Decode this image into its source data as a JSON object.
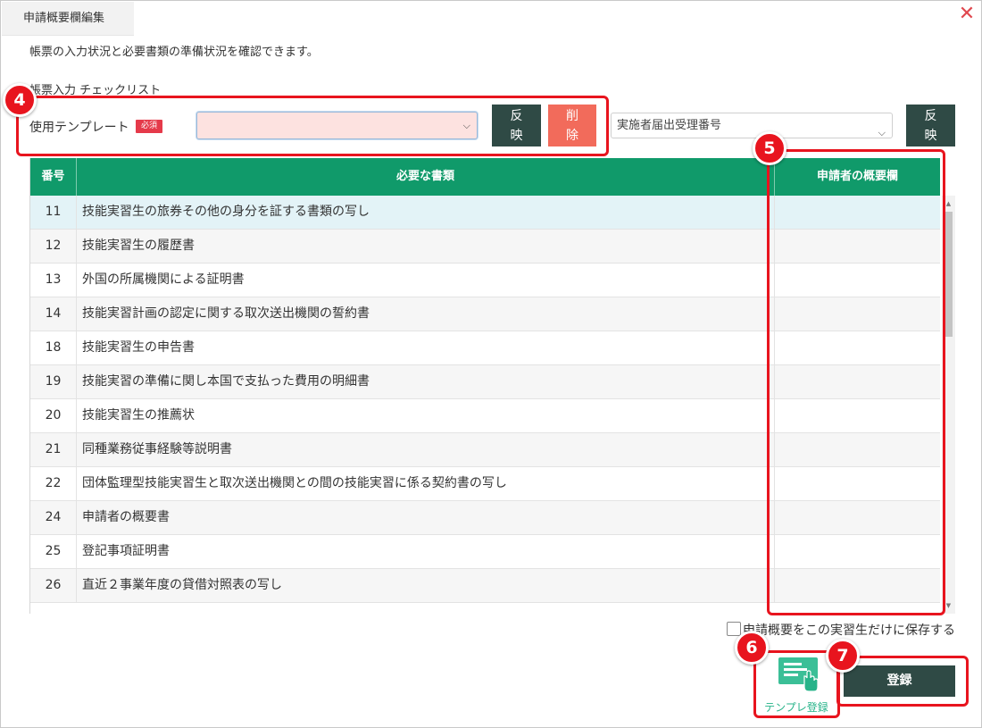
{
  "dialog": {
    "title": "申請概要欄編集",
    "close_glyph": "✕",
    "description": "帳票の入力状況と必要書類の準備状況を確認できます。",
    "section_label": "帳票入力 チェックリスト"
  },
  "template_row": {
    "label": "使用テンプレート",
    "required_badge": "必須",
    "select_value": "",
    "apply_button_line1": "反",
    "apply_button_line2": "映",
    "delete_button_line1": "削",
    "delete_button_line2": "除",
    "number_select_value": "実施者届出受理番号",
    "apply_button2_line1": "反",
    "apply_button2_line2": "映"
  },
  "table": {
    "headers": [
      "番号",
      "必要な書類",
      "申請者の概要欄"
    ],
    "rows": [
      {
        "no": "11",
        "doc": "技能実習生の旅券その他の身分を証する書類の写し",
        "summary": ""
      },
      {
        "no": "12",
        "doc": "技能実習生の履歴書",
        "summary": ""
      },
      {
        "no": "13",
        "doc": "外国の所属機関による証明書",
        "summary": ""
      },
      {
        "no": "14",
        "doc": "技能実習計画の認定に関する取次送出機関の誓約書",
        "summary": ""
      },
      {
        "no": "18",
        "doc": "技能実習生の申告書",
        "summary": ""
      },
      {
        "no": "19",
        "doc": "技能実習の準備に関し本国で支払った費用の明細書",
        "summary": ""
      },
      {
        "no": "20",
        "doc": "技能実習生の推薦状",
        "summary": ""
      },
      {
        "no": "21",
        "doc": "同種業務従事経験等説明書",
        "summary": ""
      },
      {
        "no": "22",
        "doc": "団体監理型技能実習生と取次送出機関との間の技能実習に係る契約書の写し",
        "summary": ""
      },
      {
        "no": "24",
        "doc": "申請者の概要書",
        "summary": ""
      },
      {
        "no": "25",
        "doc": "登記事項証明書",
        "summary": ""
      },
      {
        "no": "26",
        "doc": "直近２事業年度の貸借対照表の写し",
        "summary": ""
      }
    ]
  },
  "footer": {
    "checkbox_label": "申請概要をこの実習生だけに保存する",
    "checkbox_checked": false,
    "template_register_label": "テンプレ登録",
    "template_register_icon": "template-register-icon",
    "register_button": "登録"
  },
  "callouts": [
    "4",
    "5",
    "6",
    "7"
  ],
  "colors": {
    "header_green": "#109a6a",
    "dark_button": "#2f4a45",
    "delete_button": "#f26b5b",
    "required_red": "#e53a4a",
    "callout_red": "#e8141e",
    "selected_row": "#e3f3f7",
    "accent_teal": "#26b389"
  }
}
